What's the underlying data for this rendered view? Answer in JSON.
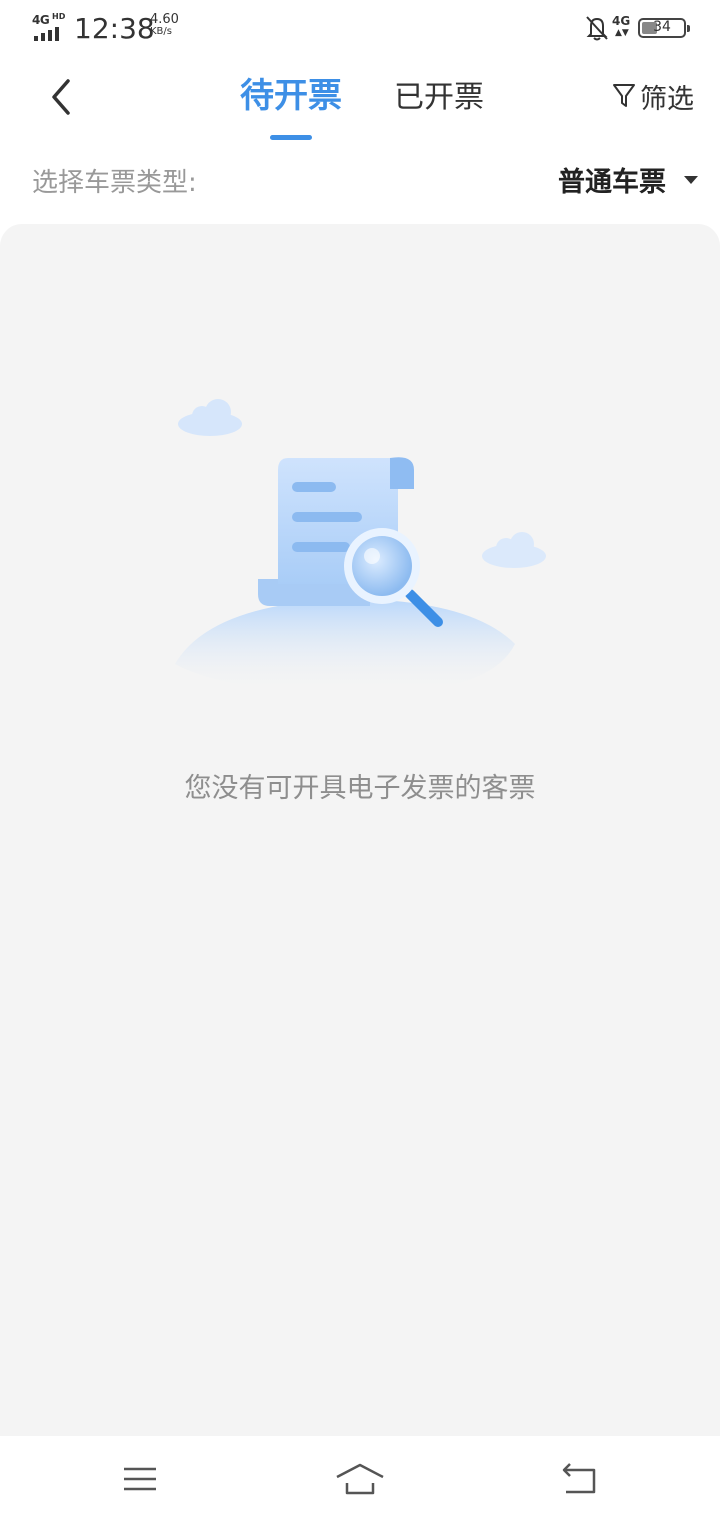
{
  "status_bar": {
    "network_label": "4G",
    "network_hd": "HD",
    "time": "12:38",
    "speed_value": "4.60",
    "speed_unit": "KB/s",
    "mobile_label": "4G",
    "battery": "34",
    "icons": [
      "signal-icon",
      "bell-off-icon",
      "4g-data-icon",
      "battery-icon"
    ]
  },
  "header": {
    "back_icon": "chevron-left-icon",
    "tabs": [
      {
        "label": "待开票",
        "active": true
      },
      {
        "label": "已开票",
        "active": false
      }
    ],
    "filter_icon": "funnel-icon",
    "filter_label": "筛选"
  },
  "ticket_type": {
    "label": "选择车票类型:",
    "selected": "普通车票",
    "caret_icon": "caret-down-icon"
  },
  "empty_state": {
    "illustration": "document-magnifier-illustration",
    "message": "您没有可开具电子发票的客票"
  },
  "bottom_nav": {
    "icons": [
      "menu-icon",
      "home-icon",
      "back-arrow-icon"
    ]
  },
  "colors": {
    "accent": "#3d8fe6",
    "panel_bg": "#f4f4f4",
    "muted_text": "#8e8e8e"
  }
}
